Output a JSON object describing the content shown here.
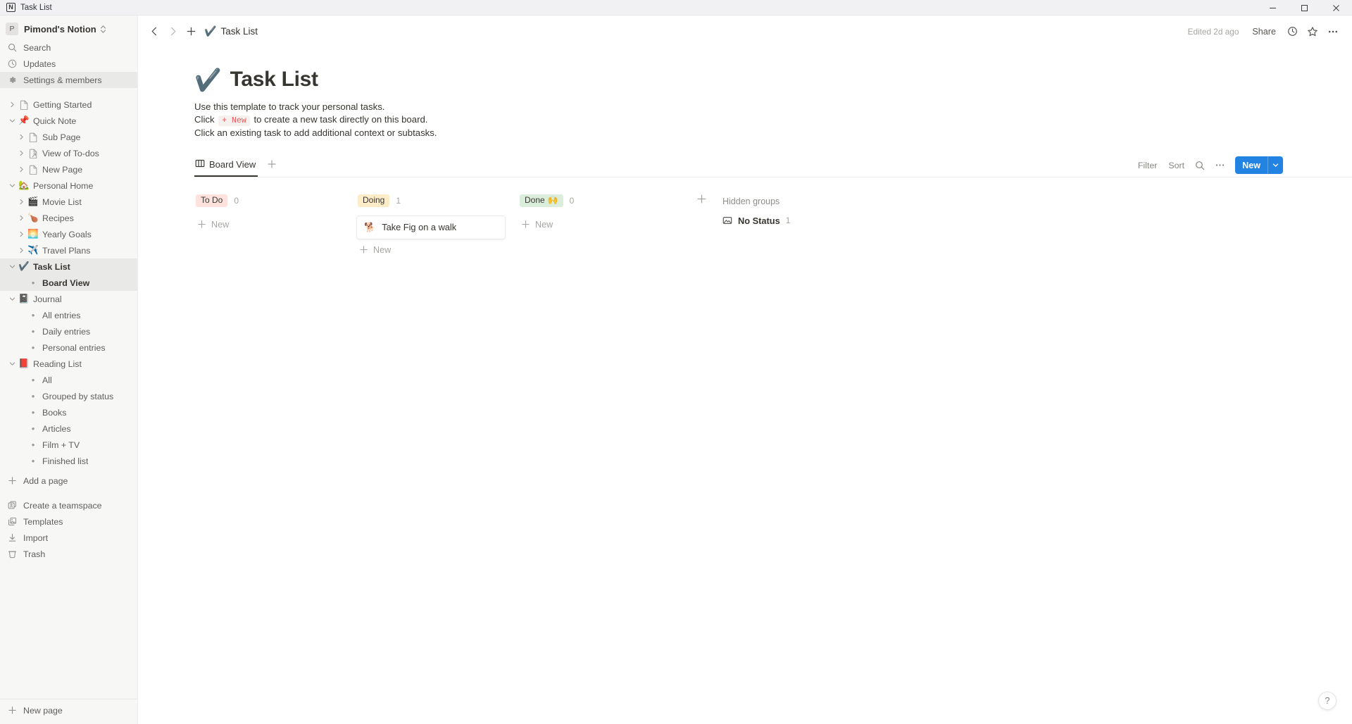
{
  "window": {
    "title": "Task List",
    "logo_letter": "N",
    "controls": [
      "minimize",
      "maximize",
      "close"
    ]
  },
  "sidebar": {
    "workspace": {
      "avatar_letter": "P",
      "name": "Pimond's Notion"
    },
    "nav": [
      {
        "label": "Search",
        "icon": "search-icon",
        "selected": false
      },
      {
        "label": "Updates",
        "icon": "clock-icon",
        "selected": false
      },
      {
        "label": "Settings & members",
        "icon": "gear-icon",
        "selected": true
      }
    ],
    "tree": [
      {
        "label": "Getting Started",
        "emoji": "📄",
        "icon": "page-icon",
        "twisty": "collapsed",
        "indent": 0,
        "selected": false,
        "bold": false
      },
      {
        "label": "Quick Note",
        "emoji": "📌",
        "twisty": "expanded",
        "indent": 0,
        "selected": false,
        "bold": false
      },
      {
        "label": "Sub Page",
        "emoji": "📄",
        "icon": "page-icon",
        "twisty": "collapsed",
        "indent": 1,
        "selected": false,
        "bold": false
      },
      {
        "label": "View of To-dos",
        "emoji": "🗒",
        "icon": "linked-page-icon",
        "twisty": "collapsed",
        "indent": 1,
        "selected": false,
        "bold": false
      },
      {
        "label": "New Page",
        "emoji": "📄",
        "icon": "page-icon",
        "twisty": "collapsed",
        "indent": 1,
        "selected": false,
        "bold": false
      },
      {
        "label": "Personal Home",
        "emoji": "🏡",
        "twisty": "expanded",
        "indent": 0,
        "selected": false,
        "bold": false
      },
      {
        "label": "Movie List",
        "emoji": "🎬",
        "twisty": "collapsed",
        "indent": 1,
        "selected": false,
        "bold": false
      },
      {
        "label": "Recipes",
        "emoji": "🍗",
        "twisty": "collapsed",
        "indent": 1,
        "selected": false,
        "bold": false
      },
      {
        "label": "Yearly Goals",
        "emoji": "🌅",
        "twisty": "collapsed",
        "indent": 1,
        "selected": false,
        "bold": false
      },
      {
        "label": "Travel Plans",
        "emoji": "✈️",
        "twisty": "collapsed",
        "indent": 1,
        "selected": false,
        "bold": false
      },
      {
        "label": "Task List",
        "emoji": "✔️",
        "twisty": "expanded",
        "indent": 0,
        "selected": true,
        "bold": true
      },
      {
        "label": "Board View",
        "emoji": "",
        "twisty": "none",
        "bullet": "•",
        "indent": 1,
        "selected": true,
        "bold": true
      },
      {
        "label": "Journal",
        "emoji": "📓",
        "twisty": "expanded",
        "indent": 0,
        "selected": false,
        "bold": false
      },
      {
        "label": "All entries",
        "emoji": "",
        "twisty": "none",
        "bullet": "•",
        "indent": 1,
        "selected": false,
        "bold": false
      },
      {
        "label": "Daily entries",
        "emoji": "",
        "twisty": "none",
        "bullet": "•",
        "indent": 1,
        "selected": false,
        "bold": false
      },
      {
        "label": "Personal entries",
        "emoji": "",
        "twisty": "none",
        "bullet": "•",
        "indent": 1,
        "selected": false,
        "bold": false
      },
      {
        "label": "Reading List",
        "emoji": "📕",
        "twisty": "expanded",
        "indent": 0,
        "selected": false,
        "bold": false
      },
      {
        "label": "All",
        "emoji": "",
        "twisty": "none",
        "bullet": "•",
        "indent": 1,
        "selected": false,
        "bold": false
      },
      {
        "label": "Grouped by status",
        "emoji": "",
        "twisty": "none",
        "bullet": "•",
        "indent": 1,
        "selected": false,
        "bold": false
      },
      {
        "label": "Books",
        "emoji": "",
        "twisty": "none",
        "bullet": "•",
        "indent": 1,
        "selected": false,
        "bold": false
      },
      {
        "label": "Articles",
        "emoji": "",
        "twisty": "none",
        "bullet": "•",
        "indent": 1,
        "selected": false,
        "bold": false
      },
      {
        "label": "Film + TV",
        "emoji": "",
        "twisty": "none",
        "bullet": "•",
        "indent": 1,
        "selected": false,
        "bold": false
      },
      {
        "label": "Finished list",
        "emoji": "",
        "twisty": "none",
        "bullet": "•",
        "indent": 1,
        "selected": false,
        "bold": false
      }
    ],
    "add_page": {
      "label": "Add a page",
      "icon": "plus-icon"
    },
    "footer": [
      {
        "label": "Create a teamspace",
        "icon": "teamspace-icon"
      },
      {
        "label": "Templates",
        "icon": "templates-icon"
      },
      {
        "label": "Import",
        "icon": "import-icon"
      },
      {
        "label": "Trash",
        "icon": "trash-icon"
      }
    ],
    "new_page": {
      "label": "New page",
      "icon": "plus-icon"
    }
  },
  "topbar": {
    "back_icon": "chevron-left-icon",
    "forward_icon": "chevron-right-icon",
    "add_icon": "plus-icon",
    "breadcrumb_emoji": "✔️",
    "breadcrumb": "Task List",
    "edited": "Edited 2d ago",
    "share": "Share",
    "updates_icon": "clock-icon",
    "favorite_icon": "star-icon",
    "more_icon": "more-horizontal-icon"
  },
  "page": {
    "title_emoji": "✔️",
    "title": "Task List",
    "description_line1": "Use this template to track your personal tasks.",
    "description_line2_pre": "Click",
    "description_line2_chip": "+ New",
    "description_line2_post": "to create a new task directly on this board.",
    "description_line3": "Click an existing task to add additional context or subtasks."
  },
  "viewbar": {
    "tab": {
      "label": "Board View",
      "icon": "board-view-icon"
    },
    "add_view_icon": "plus-icon",
    "filter": "Filter",
    "sort": "Sort",
    "search_icon": "search-icon",
    "more_icon": "more-horizontal-icon",
    "new_label": "New",
    "new_caret_icon": "chevron-down-icon",
    "accent_color": "#2383e2"
  },
  "board": {
    "columns": [
      {
        "status": "To Do",
        "status_bg": "#ffe2dd",
        "count": "0",
        "emoji": "",
        "cards": [],
        "add_label": "New"
      },
      {
        "status": "Doing",
        "status_bg": "#fdecc8",
        "count": "1",
        "emoji": "",
        "cards": [
          {
            "emoji": "🐕",
            "title": "Take Fig on a walk"
          }
        ],
        "add_label": "New"
      },
      {
        "status": "Done",
        "status_bg": "#dbeddb",
        "count": "0",
        "emoji": "🙌",
        "cards": [],
        "add_label": "New"
      }
    ],
    "add_group_icon": "plus-icon",
    "hidden_groups": {
      "title": "Hidden groups",
      "items": [
        {
          "label": "No Status",
          "count": "1",
          "icon": "no-status-icon"
        }
      ]
    }
  },
  "help": {
    "label": "?"
  }
}
